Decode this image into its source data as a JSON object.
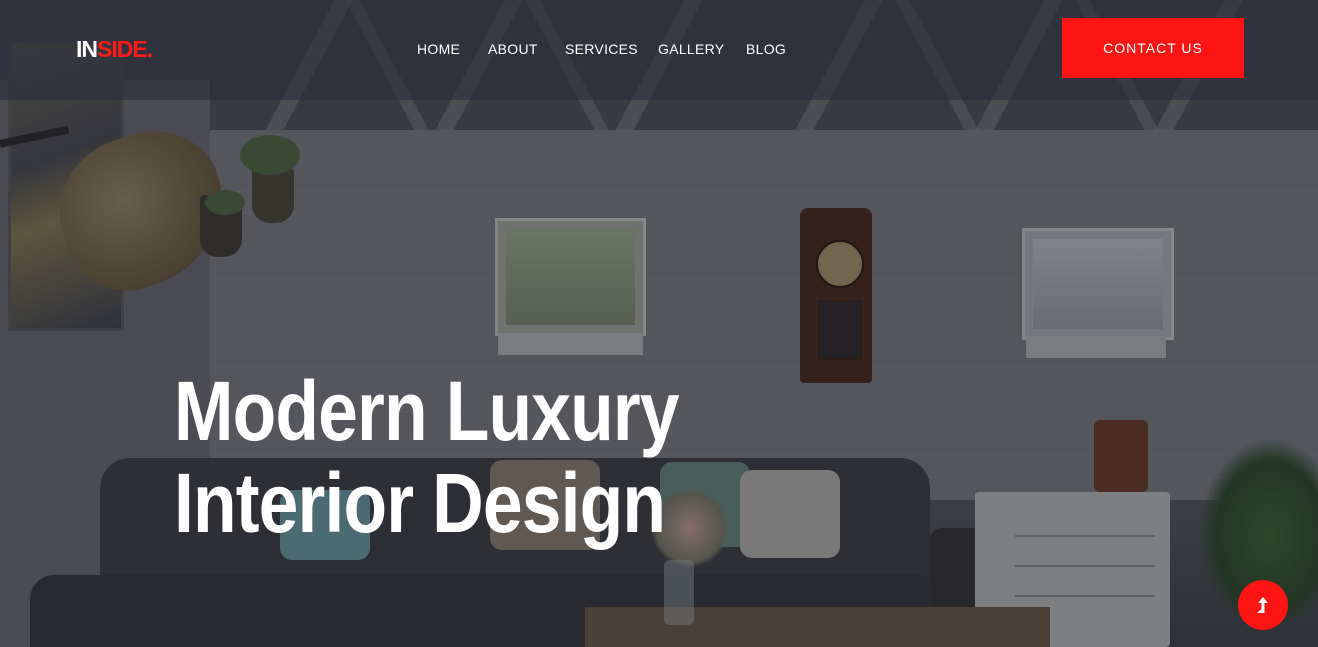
{
  "brand": {
    "logo_part1": "IN",
    "logo_part2": "SIDE.",
    "accent_color": "#ff1414"
  },
  "nav": {
    "items": [
      {
        "label": "HOME"
      },
      {
        "label": "ABOUT"
      },
      {
        "label": "SERVICES"
      },
      {
        "label": "GALLERY"
      },
      {
        "label": "BLOG"
      }
    ],
    "cta_label": "CONTACT US"
  },
  "hero": {
    "headline_line1": "Modern Luxury",
    "headline_line2": "Interior Design",
    "background": "living room with brick wall, sofa, wall clock, plants"
  },
  "scroll_top": {
    "icon": "arrow-up-icon"
  }
}
